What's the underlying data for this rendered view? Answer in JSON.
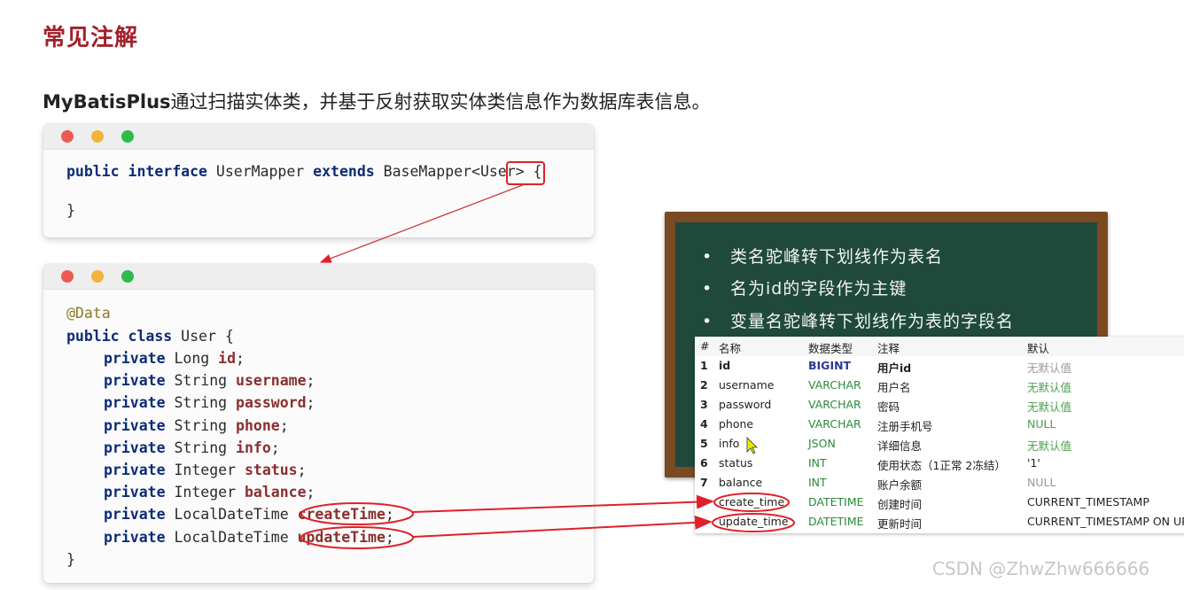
{
  "page": {
    "title": "常见注解",
    "subtitle_bold": "MyBatisPlus",
    "subtitle_rest": "通过扫描实体类，并基于反射获取实体类信息作为数据库表信息。"
  },
  "mapper_code": {
    "kw_public": "public",
    "kw_interface": "interface",
    "name": "UserMapper",
    "kw_extends": "extends",
    "base": "BaseMapper<",
    "generic": "User",
    "tail": "> {",
    "close": "}"
  },
  "entity_code": {
    "annotation": "@Data",
    "kw_public": "public",
    "kw_class": "class",
    "class_name": "User {",
    "close": "}",
    "fields": [
      {
        "mod": "private",
        "type": "Long",
        "name": "id"
      },
      {
        "mod": "private",
        "type": "String",
        "name": "username"
      },
      {
        "mod": "private",
        "type": "String",
        "name": "password"
      },
      {
        "mod": "private",
        "type": "String",
        "name": "phone"
      },
      {
        "mod": "private",
        "type": "String",
        "name": "info"
      },
      {
        "mod": "private",
        "type": "Integer",
        "name": "status"
      },
      {
        "mod": "private",
        "type": "Integer",
        "name": "balance"
      },
      {
        "mod": "private",
        "type": "LocalDateTime",
        "name": "createTime"
      },
      {
        "mod": "private",
        "type": "LocalDateTime",
        "name": "updateTime"
      }
    ]
  },
  "blackboard": {
    "bullet": "•",
    "items": [
      "类名驼峰转下划线作为表名",
      "名为id的字段作为主键",
      "变量名驼峰转下划线作为表的字段名"
    ]
  },
  "table": {
    "headers": [
      "#",
      "名称",
      "数据类型",
      "注释",
      "默认"
    ],
    "rows": [
      {
        "n": "1",
        "name": "id",
        "type": "BIGINT",
        "comment": "用户id",
        "def": "无默认值"
      },
      {
        "n": "2",
        "name": "username",
        "type": "VARCHAR",
        "comment": "用户名",
        "def": "无默认值"
      },
      {
        "n": "3",
        "name": "password",
        "type": "VARCHAR",
        "comment": "密码",
        "def": "无默认值"
      },
      {
        "n": "4",
        "name": "phone",
        "type": "VARCHAR",
        "comment": "注册手机号",
        "def": "NULL"
      },
      {
        "n": "5",
        "name": "info",
        "type": "JSON",
        "comment": "详细信息",
        "def": "无默认值"
      },
      {
        "n": "6",
        "name": "status",
        "type": "INT",
        "comment": "使用状态（1正常 2冻结）",
        "def": "'1'"
      },
      {
        "n": "7",
        "name": "balance",
        "type": "INT",
        "comment": "账户余额",
        "def": "NULL"
      },
      {
        "n": "",
        "name": "create_time",
        "type": "DATETIME",
        "comment": "创建时间",
        "def": "CURRENT_TIMESTAMP"
      },
      {
        "n": "",
        "name": "update_time",
        "type": "DATETIME",
        "comment": "更新时间",
        "def": "CURRENT_TIMESTAMP ON UP"
      }
    ]
  },
  "watermark": "CSDN @ZhwZhw666666",
  "colors": {
    "title": "#a3202a",
    "annotation_red": "#e0202a",
    "board": "#1f4a3b"
  }
}
